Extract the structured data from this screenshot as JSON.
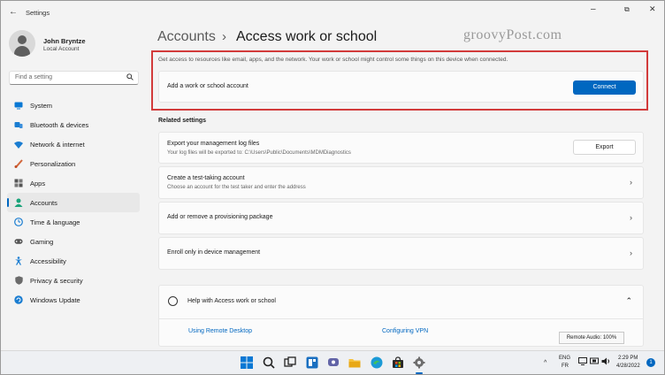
{
  "window": {
    "app_title": "Settings",
    "back_glyph": "←",
    "minimize_glyph": "–",
    "maximize_glyph": "⧉",
    "close_glyph": "✕"
  },
  "profile": {
    "name": "John Bryntze",
    "account_type": "Local Account"
  },
  "search": {
    "placeholder": "Find a setting",
    "icon": "search-icon"
  },
  "sidebar": {
    "items": [
      {
        "label": "System",
        "icon": "monitor-icon",
        "color": "#0a78d4"
      },
      {
        "label": "Bluetooth & devices",
        "icon": "bluetooth-icon",
        "color": "#1a7dd1"
      },
      {
        "label": "Network & internet",
        "icon": "wifi-icon",
        "color": "#1a7dd1"
      },
      {
        "label": "Personalization",
        "icon": "brush-icon",
        "color": "#d2663a"
      },
      {
        "label": "Apps",
        "icon": "apps-icon",
        "color": "#555555"
      },
      {
        "label": "Accounts",
        "icon": "person-icon",
        "color": "#1aa37a",
        "selected": true
      },
      {
        "label": "Time & language",
        "icon": "globe-clock-icon",
        "color": "#1a7dd1"
      },
      {
        "label": "Gaming",
        "icon": "gamepad-icon",
        "color": "#555555"
      },
      {
        "label": "Accessibility",
        "icon": "accessibility-icon",
        "color": "#1a7dd1"
      },
      {
        "label": "Privacy & security",
        "icon": "shield-icon",
        "color": "#666666"
      },
      {
        "label": "Windows Update",
        "icon": "update-icon",
        "color": "#1a7dd1"
      }
    ]
  },
  "breadcrumb": {
    "parent": "Accounts",
    "separator": "›",
    "current": "Access work or school"
  },
  "watermark": "groovyPost.com",
  "intro": "Get access to resources like email, apps, and the network. Your work or school might control some things on this device when connected.",
  "add_account": {
    "label": "Add a work or school account",
    "button": "Connect"
  },
  "related": {
    "heading": "Related settings",
    "items": [
      {
        "title": "Export your management log files",
        "subtitle": "Your log files will be exported to: C:\\Users\\Public\\Documents\\MDMDiagnostics",
        "button": "Export"
      },
      {
        "title": "Create a test-taking account",
        "subtitle": "Choose an account for the test taker and enter the address",
        "chevron": "›"
      },
      {
        "title": "Add or remove a provisioning package",
        "chevron": "›"
      },
      {
        "title": "Enroll only in device management",
        "chevron": "›"
      }
    ]
  },
  "help": {
    "title": "Help with Access work or school",
    "chevron": "⌃",
    "links": [
      "Using Remote Desktop",
      "Configuring VPN"
    ]
  },
  "tooltip": "Remote Audio: 100%",
  "taskbar": {
    "lang_top": "ENG",
    "lang_bottom": "FR",
    "time": "2:29 PM",
    "date": "4/28/2022",
    "notifications": "1",
    "accent": "#0067c0"
  }
}
